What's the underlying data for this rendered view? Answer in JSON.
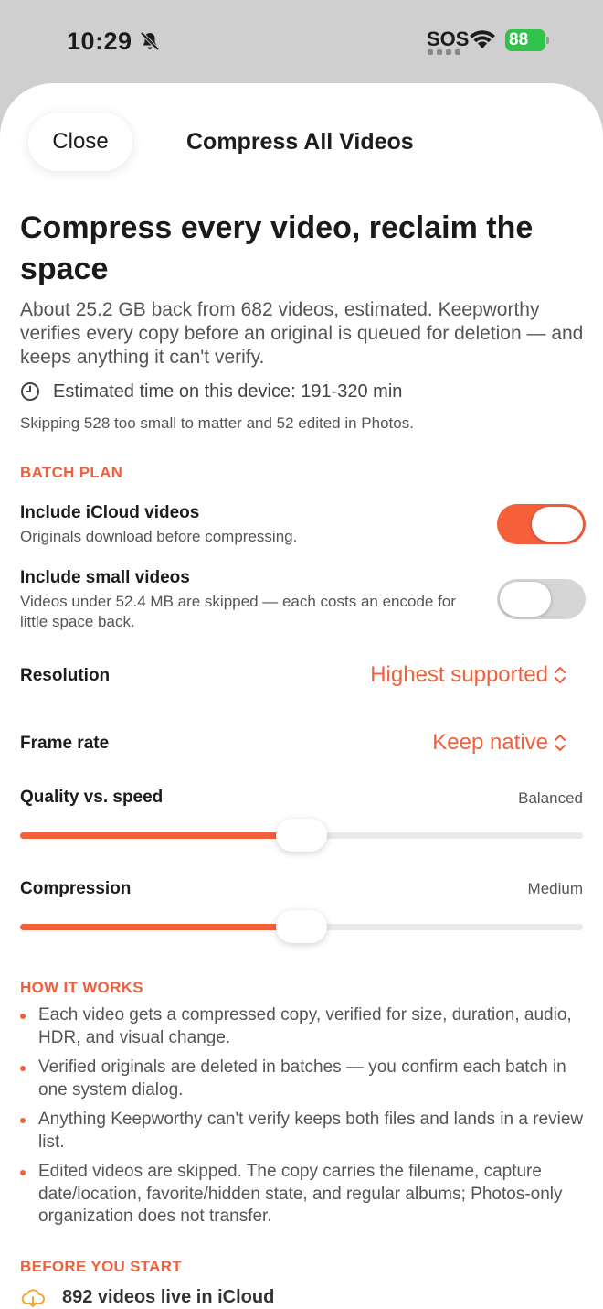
{
  "status_bar": {
    "time": "10:29",
    "sos": "SOS",
    "battery": "88"
  },
  "sheet": {
    "close_label": "Close",
    "title": "Compress All Videos"
  },
  "headline": "Compress every video, reclaim the space",
  "intro": "About 25.2 GB back from 682 videos, estimated. Keepworthy verifies every copy before an original is queued for deletion — and keeps anything it can't verify.",
  "estimate": "Estimated time on this device: 191-320 min",
  "skipping": "Skipping 528 too small to matter and 52 edited in Photos.",
  "batch_plan": {
    "label": "BATCH PLAN",
    "icloud": {
      "title": "Include iCloud videos",
      "subtitle": "Originals download before compressing.",
      "on": true
    },
    "small": {
      "title": "Include small videos",
      "subtitle": "Videos under 52.4 MB are skipped — each costs an encode for little space back.",
      "on": false
    },
    "resolution": {
      "label": "Resolution",
      "value": "Highest supported"
    },
    "frame_rate": {
      "label": "Frame rate",
      "value": "Keep native"
    },
    "quality": {
      "label": "Quality vs. speed",
      "value": "Balanced",
      "level": 0.5
    },
    "compression": {
      "label": "Compression",
      "value": "Medium",
      "level": 0.5
    }
  },
  "how_it_works": {
    "label": "HOW IT WORKS",
    "items": [
      "Each video gets a compressed copy, verified for size, duration, audio, HDR, and visual change.",
      "Verified originals are deleted in batches — you confirm each batch in one system dialog.",
      "Anything Keepworthy can't verify keeps both files and lands in a review list.",
      "Edited videos are skipped. The copy carries the filename, capture date/location, favorite/hidden state, and regular albums; Photos-only organization does not transfer."
    ]
  },
  "before_you_start": {
    "label": "BEFORE YOU START",
    "icloud_count": "892 videos live in iCloud"
  },
  "colors": {
    "accent": "#f5603b",
    "accent_text": "#f0603c",
    "battery": "#30c24a",
    "icloud_icon": "#f2a93b"
  }
}
